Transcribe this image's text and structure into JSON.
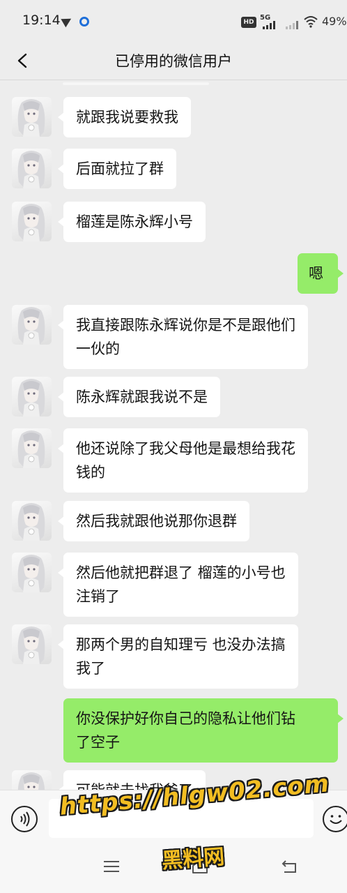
{
  "status_bar": {
    "time": "19:14",
    "network": "5G",
    "hd_label": "HD",
    "battery": "49%"
  },
  "header": {
    "title": "已停用的微信用户"
  },
  "colors": {
    "background": "#ededed",
    "incoming_bubble": "#ffffff",
    "outgoing_bubble": "#95ec69",
    "watermark": "#f2bd22"
  },
  "messages": [
    {
      "direction": "in",
      "lines": [
        "就跟我说要救我"
      ]
    },
    {
      "direction": "in",
      "lines": [
        "后面就拉了群"
      ]
    },
    {
      "direction": "in",
      "lines": [
        "榴莲是陈永辉小号"
      ]
    },
    {
      "direction": "out",
      "lines": [
        "嗯"
      ]
    },
    {
      "direction": "in",
      "lines": [
        "我直接跟陈永辉说你是不是跟他们",
        "一伙的"
      ]
    },
    {
      "direction": "in",
      "lines": [
        "陈永辉就跟我说不是"
      ]
    },
    {
      "direction": "in",
      "lines": [
        "他还说除了我父母他是最想给我花",
        "钱的"
      ]
    },
    {
      "direction": "in",
      "lines": [
        "然后我就跟他说那你退群"
      ]
    },
    {
      "direction": "in",
      "lines": [
        "然后他就把群退了 榴莲的小号也",
        "注销了"
      ]
    },
    {
      "direction": "in",
      "lines": [
        "那两个男的自知理亏 也没办法搞",
        "我了"
      ]
    },
    {
      "direction": "out",
      "lines": [
        "你没保护好你自己的隐私让他们钻",
        "了空子"
      ]
    },
    {
      "direction": "in",
      "lines": [
        "可能就去找我爸了"
      ]
    }
  ],
  "input_bar": {
    "voice_icon": "voice-icon",
    "emoji_icon": "emoji-icon",
    "placeholder": ""
  },
  "nav_bar": {
    "icons": [
      "menu-icon",
      "home-icon",
      "back-icon"
    ]
  },
  "watermark": {
    "url": "https://hlgw02.com",
    "name": "黑料网"
  }
}
